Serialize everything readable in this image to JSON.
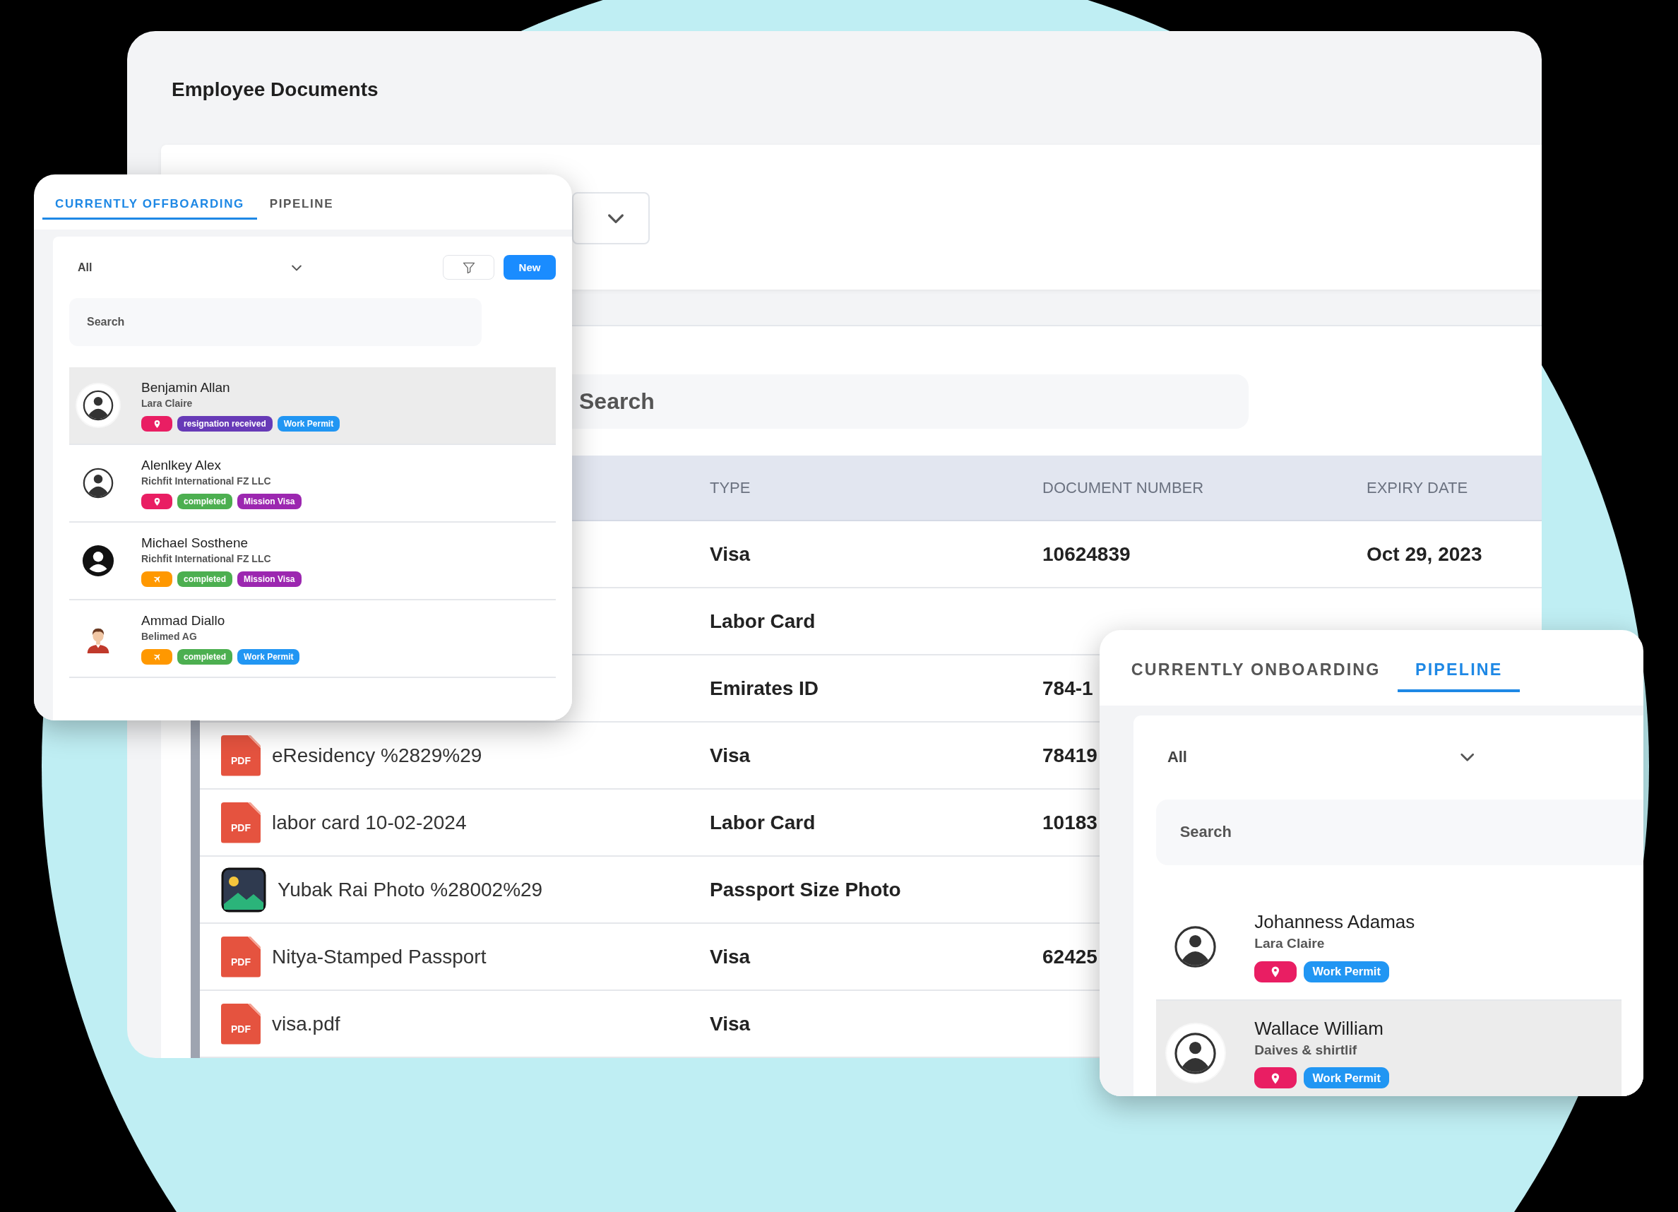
{
  "documents_window": {
    "title": "Employee Documents",
    "search": {
      "placeholder": "Search"
    },
    "table": {
      "columns": [
        "TYPE",
        "DOCUMENT NUMBER",
        "EXPIRY DATE"
      ],
      "rows": [
        {
          "type": "Visa",
          "document_number": "10624839",
          "expiry_date": "Oct 29, 2023"
        },
        {
          "type": "Labor Card"
        },
        {
          "type": "Emirates ID",
          "document_number": "784-1"
        },
        {
          "file": {
            "kind": "pdf",
            "badge": "PDF",
            "name": "eResidency %2829%29"
          },
          "type": "Visa",
          "document_number": "78419"
        },
        {
          "file": {
            "kind": "pdf",
            "badge": "PDF",
            "name": "labor card 10-02-2024"
          },
          "type": "Labor Card",
          "document_number": "10183"
        },
        {
          "file": {
            "kind": "image",
            "name": "Yubak Rai Photo %28002%29"
          },
          "type": "Passport Size Photo"
        },
        {
          "file": {
            "kind": "pdf",
            "badge": "PDF",
            "name": "Nitya-Stamped Passport"
          },
          "type": "Visa",
          "document_number": "62425"
        },
        {
          "file": {
            "kind": "pdf",
            "badge": "PDF",
            "name": "visa.pdf"
          },
          "type": "Visa"
        }
      ]
    }
  },
  "offboarding_panel": {
    "tabs": [
      {
        "label": "CURRENTLY OFFBOARDING",
        "selected": true
      },
      {
        "label": "PIPELINE",
        "selected": false
      }
    ],
    "filter": {
      "value": "All"
    },
    "actions": [
      {
        "kind": "filter"
      },
      {
        "kind": "new",
        "label": "New"
      }
    ],
    "search": {
      "placeholder": "Search"
    },
    "people": [
      {
        "name": "Benjamin Allan",
        "subtitle": "Lara Claire",
        "avatar": {
          "kind": "outline"
        },
        "selected": true,
        "tags": [
          {
            "kind": "location",
            "color": "#e91e63"
          },
          {
            "kind": "label",
            "text": "resignation received",
            "color": "#673ab7"
          },
          {
            "kind": "label",
            "text": "Work Permit",
            "color": "#2196f3"
          }
        ]
      },
      {
        "name": "Alenlkey Alex",
        "subtitle": "Richfit International FZ LLC",
        "avatar": {
          "kind": "outline"
        },
        "selected": false,
        "tags": [
          {
            "kind": "location",
            "color": "#e91e63"
          },
          {
            "kind": "label",
            "text": "completed",
            "color": "#4caf50"
          },
          {
            "kind": "label",
            "text": "Mission Visa",
            "color": "#9c27b0"
          }
        ]
      },
      {
        "name": "Michael Sosthene",
        "subtitle": "Richfit International FZ LLC",
        "avatar": {
          "kind": "solid"
        },
        "selected": false,
        "tags": [
          {
            "kind": "flight",
            "color": "#ff9800"
          },
          {
            "kind": "label",
            "text": "completed",
            "color": "#4caf50"
          },
          {
            "kind": "label",
            "text": "Mission Visa",
            "color": "#9c27b0"
          }
        ]
      },
      {
        "name": "Ammad Diallo",
        "subtitle": "Belimed AG",
        "avatar": {
          "kind": "figure"
        },
        "selected": false,
        "tags": [
          {
            "kind": "flight",
            "color": "#ff9800"
          },
          {
            "kind": "label",
            "text": "completed",
            "color": "#4caf50"
          },
          {
            "kind": "label",
            "text": "Work Permit",
            "color": "#2196f3"
          }
        ]
      }
    ]
  },
  "onboarding_panel": {
    "tabs": [
      {
        "label": "CURRENTLY ONBOARDING",
        "selected": false
      },
      {
        "label": "PIPELINE",
        "selected": true
      }
    ],
    "filter": {
      "value": "All"
    },
    "search": {
      "placeholder": "Search"
    },
    "people": [
      {
        "name": "Johanness Adamas",
        "subtitle": "Lara Claire",
        "avatar": {
          "kind": "outline"
        },
        "selected": false,
        "tags": [
          {
            "kind": "location",
            "color": "#e91e63"
          },
          {
            "kind": "label",
            "text": "Work Permit",
            "color": "#2196f3"
          }
        ]
      },
      {
        "name": "Wallace William",
        "subtitle": "Daives & shirtlif",
        "avatar": {
          "kind": "outline"
        },
        "selected": true,
        "tags": [
          {
            "kind": "location",
            "color": "#e91e63"
          },
          {
            "kind": "label",
            "text": "Work Permit",
            "color": "#2196f3"
          }
        ]
      }
    ]
  }
}
